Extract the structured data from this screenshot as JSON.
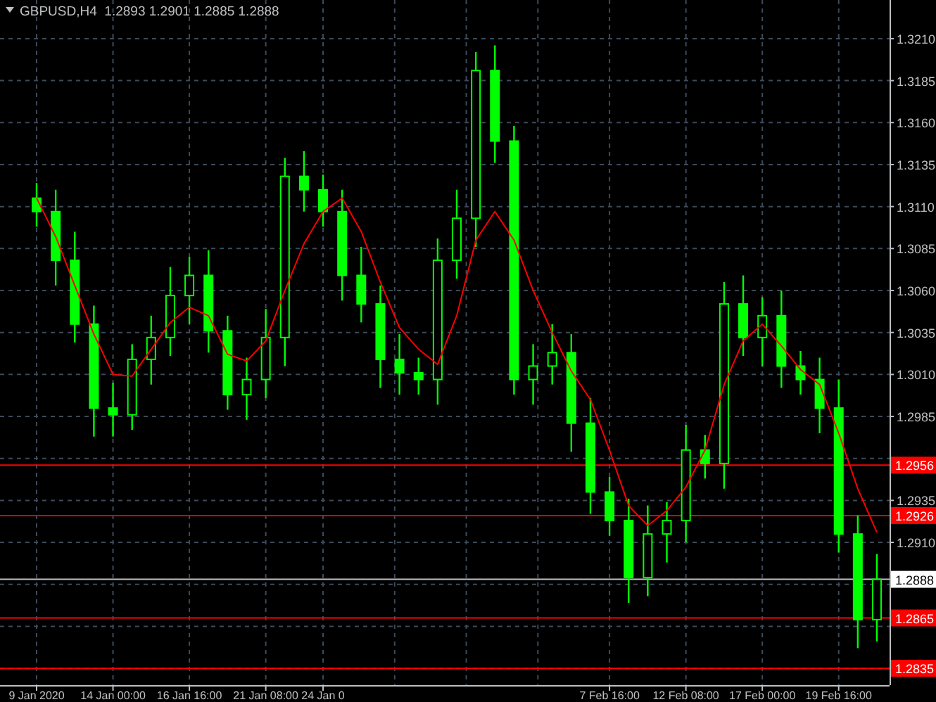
{
  "chart": {
    "chart_data": {
      "type": "candlestick",
      "title": "GBPUSD,H4  1.2893 1.2901 1.2885 1.2888",
      "grid": true,
      "categories": [
        "9 Jan 2020",
        null,
        null,
        null,
        "14 Jan 00:00",
        null,
        null,
        null,
        "16 Jan 16:00",
        null,
        null,
        null,
        "21 Jan 08:00",
        null,
        null,
        "24 Jan 0",
        null,
        null,
        null,
        null,
        null,
        null,
        null,
        null,
        null,
        null,
        null,
        null,
        null,
        null,
        "7 Feb 16:00",
        null,
        null,
        null,
        "12 Feb 08:00",
        null,
        null,
        null,
        "17 Feb 00:00",
        null,
        null,
        null,
        "19 Feb 16:00",
        null,
        null
      ],
      "ohlc": [
        [
          1.3115,
          1.3124,
          1.3098,
          1.3107
        ],
        [
          1.3107,
          1.312,
          1.3063,
          1.3078
        ],
        [
          1.3078,
          1.3095,
          1.3029,
          1.304
        ],
        [
          1.304,
          1.3051,
          1.2973,
          1.299
        ],
        [
          1.299,
          1.3005,
          1.2973,
          1.2986
        ],
        [
          1.2986,
          1.3028,
          1.2977,
          1.3019
        ],
        [
          1.3019,
          1.3045,
          1.3004,
          1.3032
        ],
        [
          1.3032,
          1.3074,
          1.3021,
          1.3057
        ],
        [
          1.3057,
          1.308,
          1.304,
          1.3069
        ],
        [
          1.3069,
          1.3084,
          1.3023,
          1.3036
        ],
        [
          1.3036,
          1.3045,
          1.2989,
          1.2998
        ],
        [
          1.2998,
          1.302,
          1.2983,
          1.3007
        ],
        [
          1.3007,
          1.3049,
          1.2996,
          1.3032
        ],
        [
          1.3032,
          1.3139,
          1.3015,
          1.3128
        ],
        [
          1.3128,
          1.3143,
          1.3107,
          1.312
        ],
        [
          1.312,
          1.3129,
          1.3098,
          1.3107
        ],
        [
          1.3107,
          1.312,
          1.3054,
          1.3069
        ],
        [
          1.3069,
          1.3086,
          1.3041,
          1.3052
        ],
        [
          1.3052,
          1.3063,
          1.3002,
          1.3019
        ],
        [
          1.3019,
          1.3034,
          1.2998,
          1.3011
        ],
        [
          1.3011,
          1.302,
          1.2998,
          1.3007
        ],
        [
          1.3007,
          1.3091,
          1.2992,
          1.3078
        ],
        [
          1.3078,
          1.312,
          1.3067,
          1.3103
        ],
        [
          1.3103,
          1.3202,
          1.3086,
          1.3191
        ],
        [
          1.3191,
          1.3206,
          1.3136,
          1.3149
        ],
        [
          1.3149,
          1.3158,
          1.2998,
          1.3007
        ],
        [
          1.3007,
          1.3028,
          1.2992,
          1.3015
        ],
        [
          1.3015,
          1.304,
          1.3004,
          1.3023
        ],
        [
          1.3023,
          1.3034,
          1.2964,
          1.2981
        ],
        [
          1.2981,
          1.2996,
          1.2927,
          1.294
        ],
        [
          1.294,
          1.2949,
          1.2914,
          1.2923
        ],
        [
          1.2923,
          1.2936,
          1.2874,
          1.2889
        ],
        [
          1.2889,
          1.2932,
          1.2878,
          1.2915
        ],
        [
          1.2915,
          1.2934,
          1.2898,
          1.2923
        ],
        [
          1.2923,
          1.298,
          1.291,
          1.2965
        ],
        [
          1.2965,
          1.2974,
          1.2948,
          1.2957
        ],
        [
          1.2957,
          1.3065,
          1.2942,
          1.3052
        ],
        [
          1.3052,
          1.3069,
          1.3021,
          1.3032
        ],
        [
          1.3032,
          1.3056,
          1.3015,
          1.3045
        ],
        [
          1.3045,
          1.306,
          1.3002,
          1.3015
        ],
        [
          1.3015,
          1.3024,
          1.2998,
          1.3007
        ],
        [
          1.3007,
          1.302,
          1.2975,
          1.299
        ],
        [
          1.299,
          1.3007,
          1.2904,
          1.2915
        ],
        [
          1.2915,
          1.2926,
          1.2847,
          1.2864
        ],
        [
          1.2864,
          1.2903,
          1.2851,
          1.2888
        ]
      ],
      "series": [
        {
          "type": "line",
          "color": "#ff0000",
          "values": [
            1.3115,
            1.3092,
            1.3063,
            1.3034,
            1.301,
            1.3009,
            1.3025,
            1.3041,
            1.305,
            1.3045,
            1.3022,
            1.3018,
            1.303,
            1.306,
            1.3088,
            1.3107,
            1.3115,
            1.3095,
            1.3065,
            1.3038,
            1.3025,
            1.3016,
            1.3045,
            1.309,
            1.3107,
            1.309,
            1.306,
            1.3035,
            1.3012,
            1.2995,
            1.2965,
            1.2932,
            1.292,
            1.2929,
            1.2943,
            1.2965,
            1.3004,
            1.303,
            1.304,
            1.3027,
            1.3013,
            1.3004,
            1.2975,
            1.2942,
            1.2916
          ]
        }
      ],
      "ylim": [
        1.2825,
        1.3233
      ],
      "yticks": [
        {
          "value": 1.321,
          "label": "1.3210"
        },
        {
          "value": 1.3185,
          "label": "1.3185"
        },
        {
          "value": 1.316,
          "label": "1.3160"
        },
        {
          "value": 1.3135,
          "label": "1.3135"
        },
        {
          "value": 1.311,
          "label": "1.3110"
        },
        {
          "value": 1.3085,
          "label": "1.3085"
        },
        {
          "value": 1.306,
          "label": "1.3060"
        },
        {
          "value": 1.3035,
          "label": "1.3035"
        },
        {
          "value": 1.301,
          "label": "1.3010"
        },
        {
          "value": 1.2985,
          "label": "1.2985"
        },
        {
          "value": 1.2935,
          "label": "1.2935"
        },
        {
          "value": 1.291,
          "label": "1.2910"
        }
      ],
      "ref_lines": [
        {
          "axis": "y",
          "value": 1.2956,
          "label": "1.2956",
          "color": "#ff0000"
        },
        {
          "axis": "y",
          "value": 1.2926,
          "label": "1.2926",
          "color": "#ff0000"
        },
        {
          "axis": "y",
          "value": 1.2888,
          "label": "1.2888",
          "color": "#c0c0c0"
        },
        {
          "axis": "y",
          "value": 1.2865,
          "label": "1.2865",
          "color": "#ff0000"
        },
        {
          "axis": "y",
          "value": 1.2835,
          "label": "1.2835",
          "color": "#ff0000"
        }
      ]
    }
  }
}
